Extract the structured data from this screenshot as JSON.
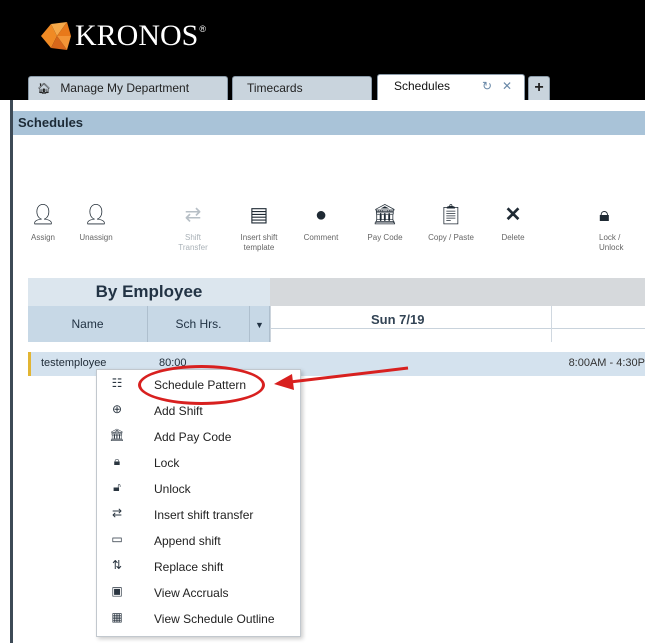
{
  "brand": {
    "name": "KRONOS",
    "mark": "®",
    "colors": {
      "orange": "#f08a24",
      "tab_active": "#ffffff",
      "accent": "#d8201f"
    }
  },
  "tabs": [
    {
      "label": "Manage My Department",
      "icon": "home-icon"
    },
    {
      "label": "Timecards"
    },
    {
      "label": "Schedules",
      "icons": [
        "refresh-icon",
        "close-icon"
      ],
      "active": true
    }
  ],
  "tab_add_icon": "plus-icon",
  "panel": {
    "title": "Schedules"
  },
  "toolbar": [
    {
      "label": "Assign",
      "icon": "assign-user-icon"
    },
    {
      "label": "Unassign",
      "icon": "unassign-user-icon"
    },
    {
      "label": "Shift Transfer",
      "icon": "shift-transfer-icon",
      "disabled": true
    },
    {
      "label": "Insert shift template",
      "icon": "insert-template-icon"
    },
    {
      "label": "Comment",
      "icon": "comment-icon"
    },
    {
      "label": "Pay Code",
      "icon": "bank-icon"
    },
    {
      "label": "Copy / Paste",
      "icon": "copy-paste-icon"
    },
    {
      "label": "Delete",
      "icon": "delete-icon"
    },
    {
      "label": "Lock / Unlock",
      "icon": "lock-icon"
    }
  ],
  "grid": {
    "group_title": "By Employee",
    "columns": [
      "Name",
      "Sch Hrs."
    ],
    "day": "Sun 7/19",
    "rows": [
      {
        "name": "testemployee",
        "hours": "80:00",
        "shift": "8:00AM - 4:30P"
      }
    ]
  },
  "context_menu": [
    {
      "label": "Schedule Pattern",
      "icon": "schedule-pattern-icon",
      "highlighted": true
    },
    {
      "label": "Add Shift",
      "icon": "add-shift-icon"
    },
    {
      "label": "Add Pay Code",
      "icon": "add-pay-code-icon"
    },
    {
      "label": "Lock",
      "icon": "lock-icon"
    },
    {
      "label": "Unlock",
      "icon": "unlock-icon"
    },
    {
      "label": "Insert shift transfer",
      "icon": "shift-transfer-icon"
    },
    {
      "label": "Append shift",
      "icon": "append-shift-icon"
    },
    {
      "label": "Replace shift",
      "icon": "replace-shift-icon"
    },
    {
      "label": "View Accruals",
      "icon": "accruals-icon"
    },
    {
      "label": "View Schedule Outline",
      "icon": "schedule-outline-icon"
    }
  ]
}
